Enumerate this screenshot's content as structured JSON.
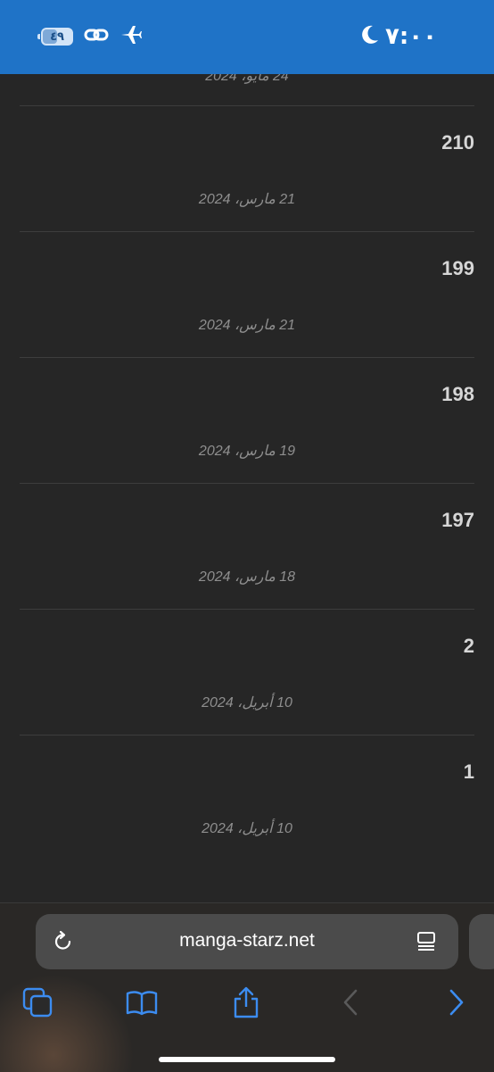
{
  "status_bar": {
    "time": "٧:٠٠",
    "battery_level": "٤٩",
    "battery_percent": 49,
    "icons": [
      "moon-icon",
      "airplane-icon",
      "link-icon",
      "battery-icon"
    ],
    "background_color": "#1f73c7"
  },
  "chapters": {
    "partial_top_date": "24 مايو، 2024",
    "items": [
      {
        "number": "210",
        "date": "21 مارس، 2024"
      },
      {
        "number": "199",
        "date": "21 مارس، 2024"
      },
      {
        "number": "198",
        "date": "19 مارس، 2024"
      },
      {
        "number": "197",
        "date": "18 مارس، 2024"
      },
      {
        "number": "2",
        "date": "10 أبريل، 2024"
      },
      {
        "number": "1",
        "date": "10 أبريل، 2024"
      }
    ]
  },
  "browser": {
    "url": "manga-starz.net",
    "icons": [
      "reload-icon",
      "reader-mode-icon",
      "tabs-icon",
      "bookmarks-icon",
      "share-icon",
      "back-icon",
      "forward-icon"
    ],
    "accent_color": "#3c8cf0"
  }
}
